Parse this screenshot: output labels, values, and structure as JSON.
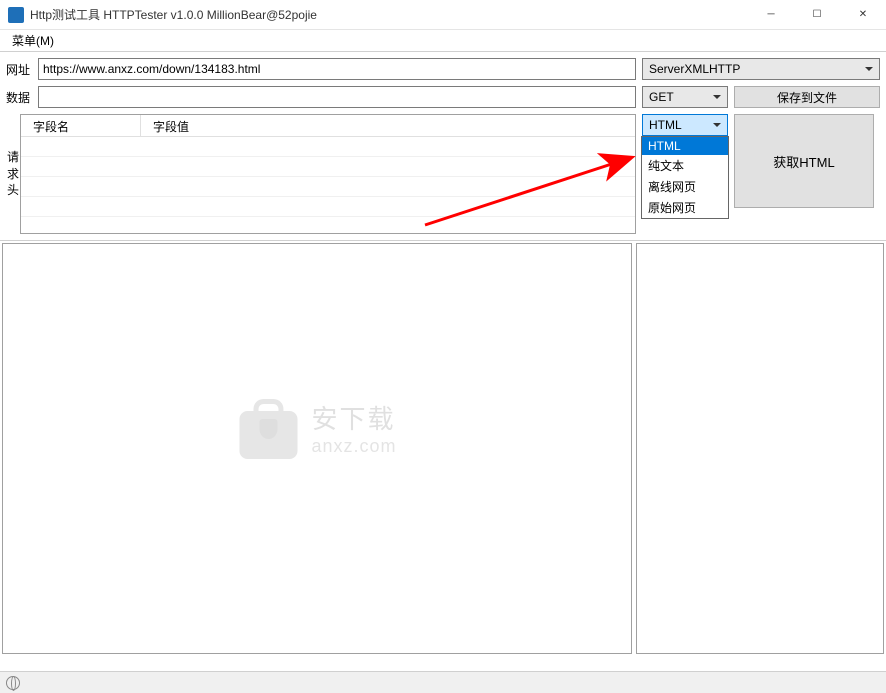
{
  "window": {
    "title": "Http测试工具 HTTPTester v1.0.0   MillionBear@52pojie"
  },
  "menu": {
    "label": "菜单(M)"
  },
  "form": {
    "url_label": "网址",
    "url_value": "https://www.anxz.com/down/134183.html",
    "data_label": "数据",
    "data_value": "",
    "headers_label": [
      "请",
      "求",
      "头"
    ],
    "header_columns": {
      "name": "字段名",
      "value": "字段值"
    }
  },
  "controls": {
    "engine_select": "ServerXMLHTTP",
    "method_select": "GET",
    "format_select": "HTML",
    "format_options": [
      "HTML",
      "纯文本",
      "离线网页",
      "原始网页"
    ],
    "save_button": "保存到文件",
    "fetch_button": "获取HTML"
  },
  "watermark": {
    "cn": "安下载",
    "en": "anxz.com"
  }
}
